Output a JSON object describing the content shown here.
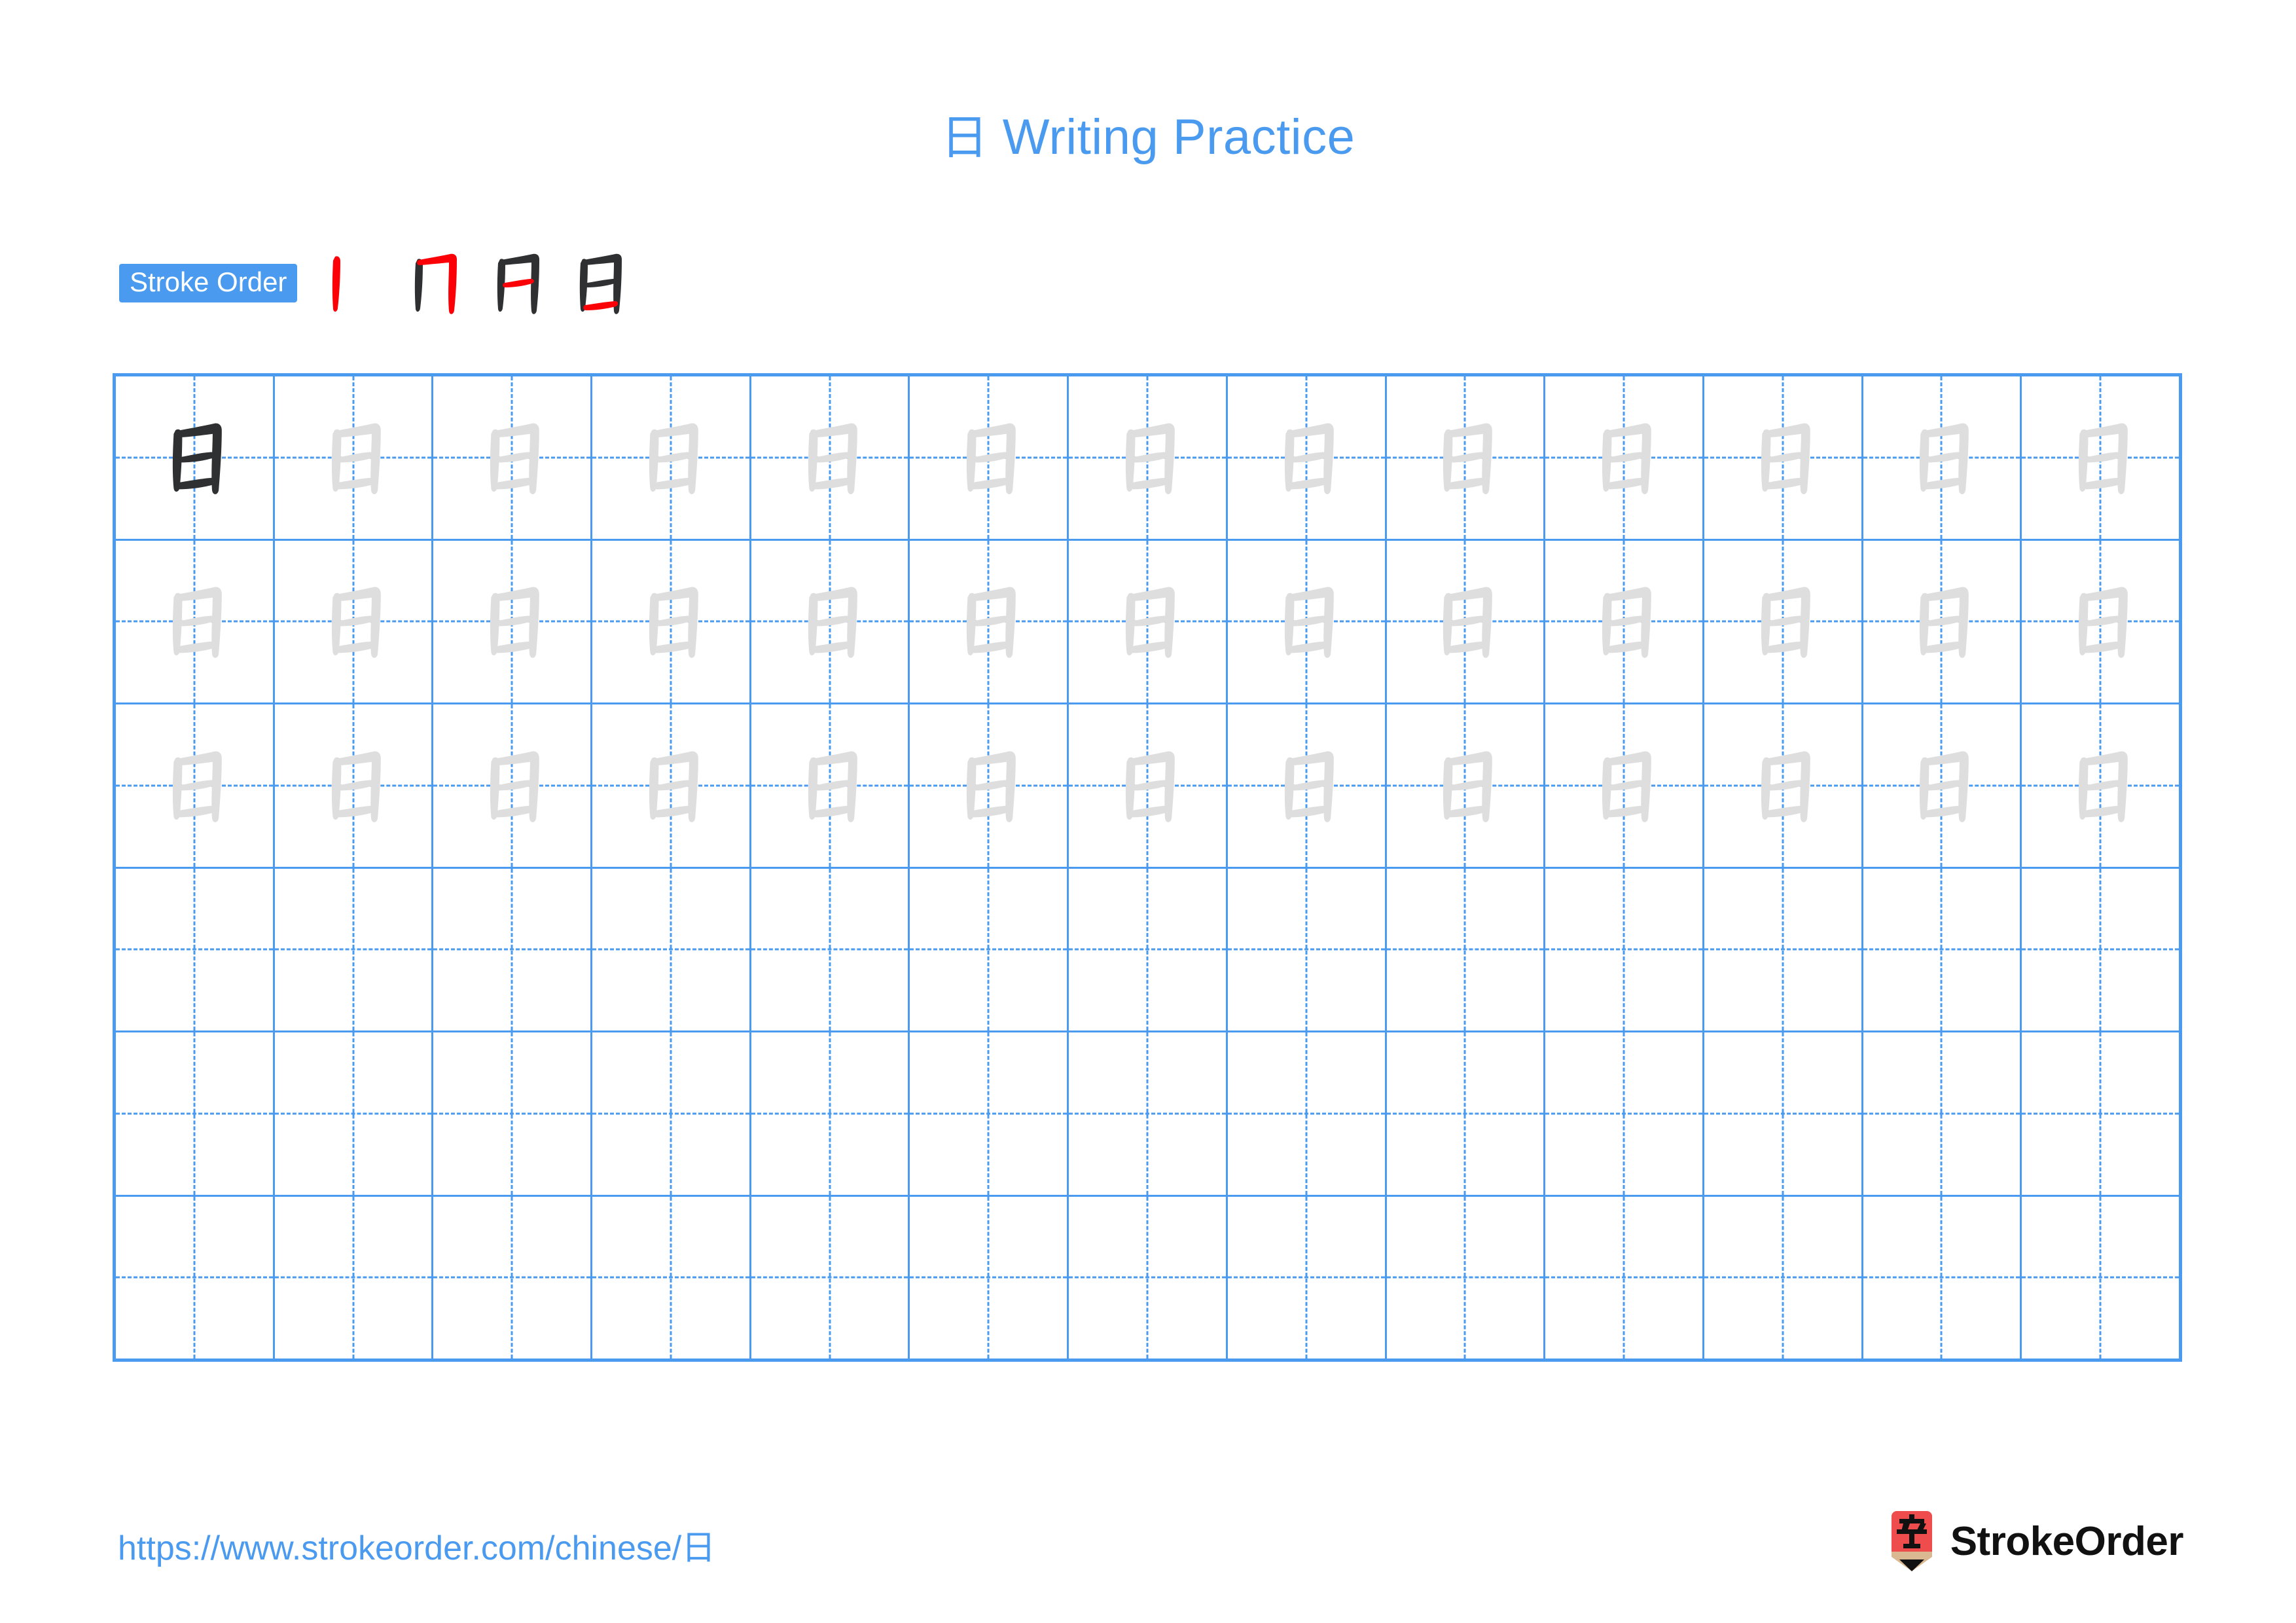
{
  "character": "日",
  "page": {
    "title_prefix": "日",
    "title_text": " Writing Practice",
    "title_full": "日 Writing Practice",
    "background_color": "#ffffff"
  },
  "colors": {
    "accent_blue": "#4a9bf0",
    "grid_blue": "#4a9bf0",
    "stroke_highlight_red": "#fb0007",
    "stroke_ink_black": "#2f3031",
    "trace_gray": "#dedede",
    "logo_red": "#ef4d4d",
    "logo_tan": "#d9b892",
    "logo_text_black": "#111111"
  },
  "stroke_order": {
    "badge_label": "Stroke Order",
    "total_strokes": 4,
    "steps": [
      {
        "index": 1,
        "name": "vertical",
        "new_stroke_color": "#fb0007"
      },
      {
        "index": 2,
        "name": "horizontal-turn-vertical-hook",
        "new_stroke_color": "#fb0007"
      },
      {
        "index": 3,
        "name": "middle-horizontal",
        "new_stroke_color": "#fb0007"
      },
      {
        "index": 4,
        "name": "bottom-horizontal",
        "new_stroke_color": "#fb0007"
      }
    ]
  },
  "practice_grid": {
    "columns": 13,
    "rows": 6,
    "filled_rows": 3,
    "empty_rows": 3,
    "guide_style": "dashed-cross",
    "first_cell_style": "dark-model",
    "trace_cell_style": "light-gray-trace",
    "row_fill": [
      {
        "row": 1,
        "dark_cells": 1,
        "trace_cells": 12
      },
      {
        "row": 2,
        "dark_cells": 0,
        "trace_cells": 13
      },
      {
        "row": 3,
        "dark_cells": 0,
        "trace_cells": 13
      },
      {
        "row": 4,
        "dark_cells": 0,
        "trace_cells": 0
      },
      {
        "row": 5,
        "dark_cells": 0,
        "trace_cells": 0
      },
      {
        "row": 6,
        "dark_cells": 0,
        "trace_cells": 0
      }
    ]
  },
  "footer": {
    "url": "https://www.strokeorder.com/chinese/日",
    "brand_name": "StrokeOrder",
    "brand_mark_char": "字"
  }
}
